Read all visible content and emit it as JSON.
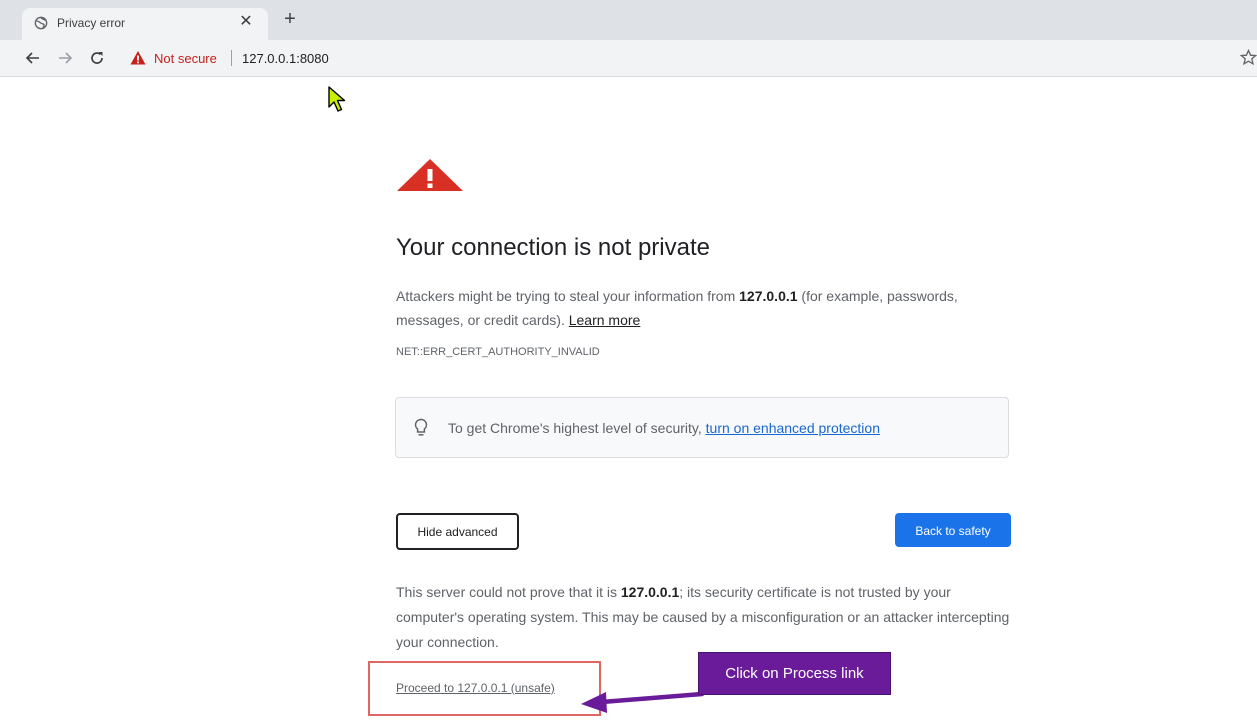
{
  "browser": {
    "tab": {
      "title": "Privacy error",
      "favicon": "globe-icon",
      "close_icon": "close-icon"
    },
    "new_tab_icon": "plus-icon",
    "nav": {
      "back_icon": "back-arrow-icon",
      "forward_icon": "forward-arrow-icon",
      "reload_icon": "reload-icon"
    },
    "omnibox": {
      "security_icon": "warning-triangle-icon",
      "security_label": "Not secure",
      "url": "127.0.0.1:8080"
    },
    "bookmark_icon": "star-icon"
  },
  "page": {
    "icon": "warning-triangle-icon",
    "heading": "Your connection is not private",
    "intro": {
      "prefix": "Attackers might be trying to steal your information from ",
      "host": "127.0.0.1",
      "suffix": " (for example, passwords, messages, or credit cards). ",
      "learn_more": "Learn more"
    },
    "error_code": "NET::ERR_CERT_AUTHORITY_INVALID",
    "enhanced": {
      "icon": "lightbulb-icon",
      "text": "To get Chrome's highest level of security, ",
      "link": "turn on enhanced protection"
    },
    "buttons": {
      "hide_advanced": "Hide advanced",
      "back_to_safety": "Back to safety"
    },
    "details": {
      "prefix": "This server could not prove that it is ",
      "host": "127.0.0.1",
      "suffix": "; its security certificate is not trusted by your computer's operating system. This may be caused by a misconfiguration or an attacker intercepting your connection."
    },
    "proceed_link": "Proceed to 127.0.0.1 (unsafe)"
  },
  "annotation": {
    "callout": "Click on Process link",
    "callout_color": "#6a1b9a",
    "highlight_color": "#e06666"
  },
  "colors": {
    "tab_strip": "#dee1e6",
    "toolbar": "#f1f3f4",
    "warning_red": "#c5221f",
    "primary_blue": "#1a73e8",
    "link_blue": "#1967d2"
  }
}
